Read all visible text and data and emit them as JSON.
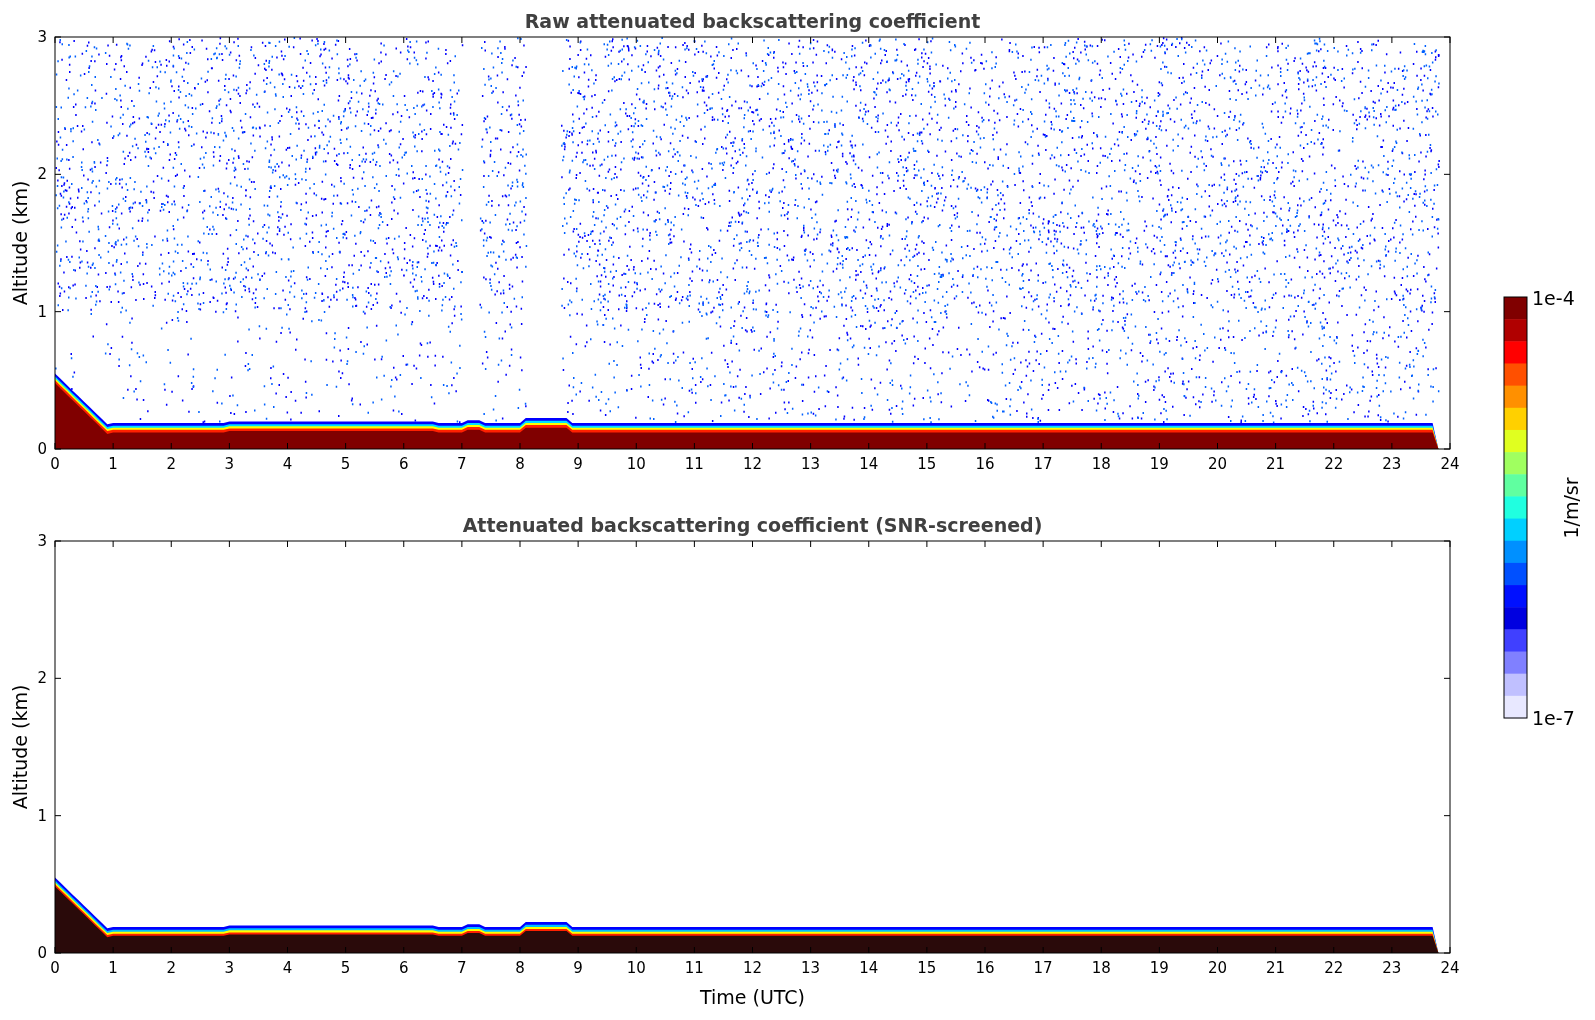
{
  "panels": [
    {
      "kind": "raw",
      "title": "Raw attenuated backscattering coefficient",
      "ylabel": "Altitude (km)",
      "yticks": [
        "3",
        "2",
        "1",
        "0"
      ],
      "xticks": [
        "0",
        "1",
        "2",
        "3",
        "4",
        "5",
        "6",
        "7",
        "8",
        "9",
        "10",
        "11",
        "12",
        "13",
        "14",
        "15",
        "16",
        "17",
        "18",
        "19",
        "20",
        "21",
        "22",
        "23",
        "24"
      ]
    },
    {
      "kind": "screened",
      "title": "Attenuated backscattering coefficient (SNR-screened)",
      "ylabel": "Altitude (km)",
      "xlabel": "Time (UTC)",
      "yticks": [
        "3",
        "2",
        "1",
        "0"
      ],
      "xticks": [
        "0",
        "1",
        "2",
        "3",
        "4",
        "5",
        "6",
        "7",
        "8",
        "9",
        "10",
        "11",
        "12",
        "13",
        "14",
        "15",
        "16",
        "17",
        "18",
        "19",
        "20",
        "21",
        "22",
        "23",
        "24"
      ]
    }
  ],
  "colorbar": {
    "label": "1/m/sr",
    "max_label": "1e-4",
    "min_label": "1e-7"
  }
}
